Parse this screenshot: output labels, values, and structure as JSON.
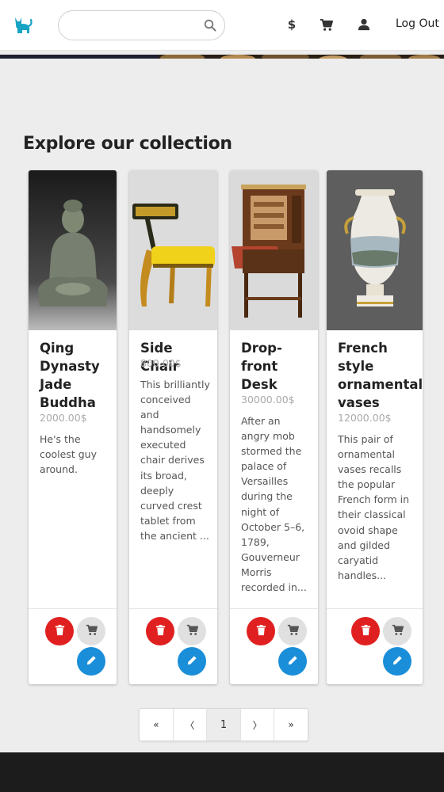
{
  "header": {
    "search_placeholder": "",
    "currency_symbol": "$",
    "logout_label": "Log Out",
    "brand_color": "#17a3c4"
  },
  "main": {
    "section_title": "Explore our collection"
  },
  "products": [
    {
      "title": "Qing Dynasty Jade Buddha",
      "price": "2000.00$",
      "description": "He's the coolest guy around.",
      "image_icon": "jade-buddha-image"
    },
    {
      "title": "Side Chair",
      "price": "800.00$",
      "description": "This brilliantly conceived and handsomely executed chair derives its broad, deeply curved crest tablet from the ancient ...",
      "image_icon": "side-chair-image"
    },
    {
      "title": "Drop-front Desk",
      "price": "30000.00$",
      "description": "After an angry mob stormed the palace of Versailles during the night of October 5–6, 1789, Gouverneur Morris recorded in...",
      "image_icon": "desk-image"
    },
    {
      "title": "French style ornamental vases",
      "price": "12000.00$",
      "description": "This pair of ornamental vases recalls the popular French form in their classical ovoid shape and gilded caryatid handles...",
      "image_icon": "vase-image"
    }
  ],
  "pagination": {
    "first": "«",
    "prev": "〈",
    "current": "1",
    "next": "〉",
    "last": "»"
  },
  "colors": {
    "delete": "#e02020",
    "add_to_cart": "#e0e0e0",
    "edit": "#1a8ed8"
  }
}
